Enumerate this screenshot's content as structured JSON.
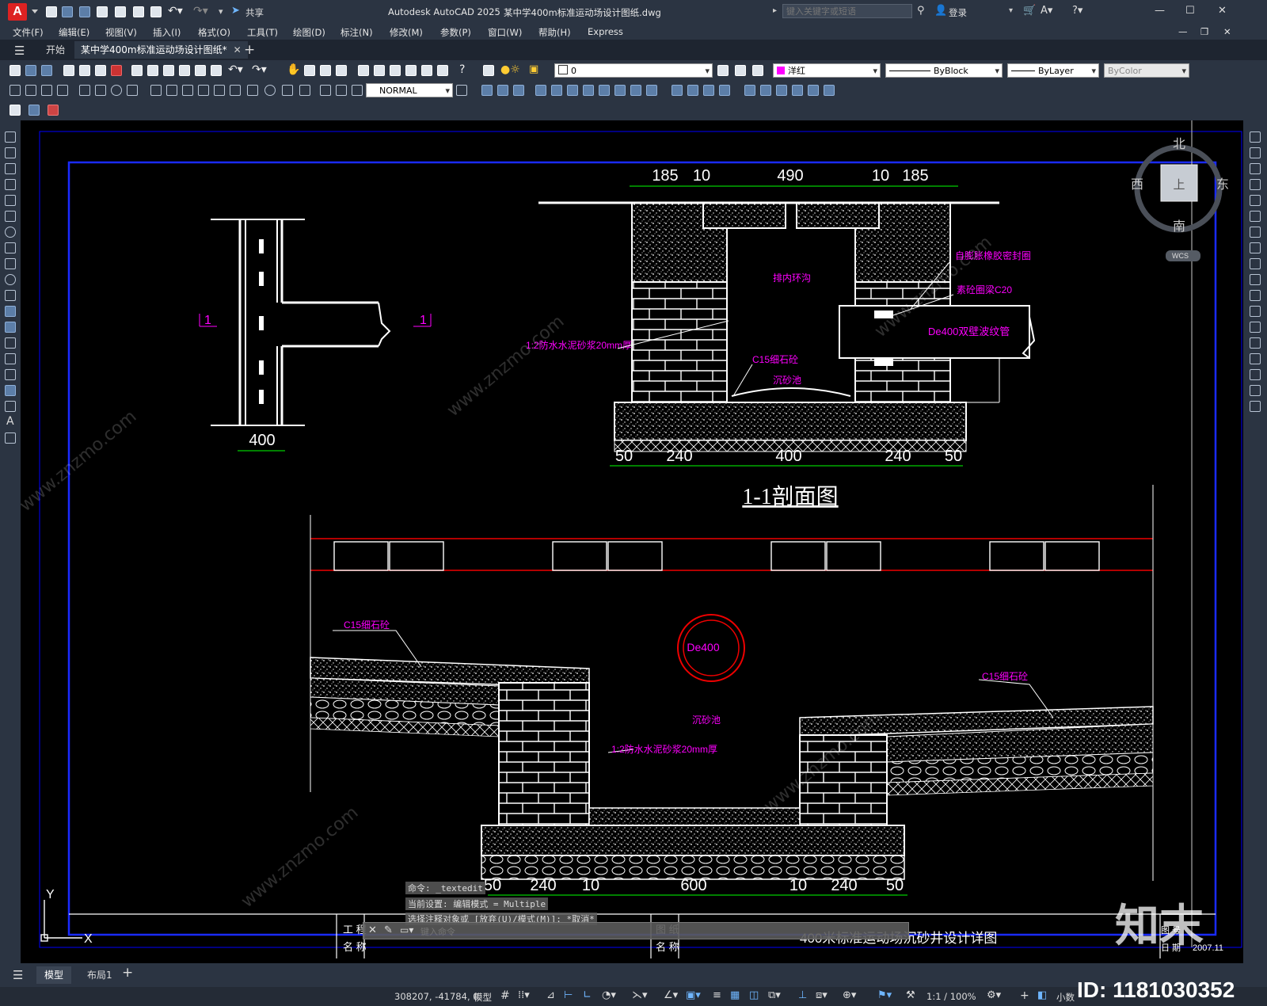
{
  "app": {
    "title": "Autodesk AutoCAD 2025",
    "filename": "某中学400m标准运动场设计图纸.dwg",
    "share": "共享",
    "search_placeholder": "键入关键字或短语",
    "login": "登录"
  },
  "menu": [
    "文件(F)",
    "编辑(E)",
    "视图(V)",
    "插入(I)",
    "格式(O)",
    "工具(T)",
    "绘图(D)",
    "标注(N)",
    "修改(M)",
    "参数(P)",
    "窗口(W)",
    "帮助(H)",
    "Express"
  ],
  "tabs": {
    "start": "开始",
    "doc": "某中学400m标准运动场设计图纸*"
  },
  "toolbar": {
    "layer": "0",
    "color": "洋红",
    "linetype": "ByBlock",
    "lineweight": "ByLayer",
    "plotstyle": "ByColor",
    "dimstyle": "NORMAL"
  },
  "viewcube": {
    "north": "北",
    "south": "南",
    "east": "东",
    "west": "西",
    "top": "上",
    "wcs": "WCS"
  },
  "drawing": {
    "dims_top": [
      "185",
      "10",
      "490",
      "10",
      "185"
    ],
    "dims_left": [
      "400"
    ],
    "dims_section_bottom": [
      "50",
      "240",
      "400",
      "240",
      "50"
    ],
    "section_title": "1-1剖面图",
    "section_marks": [
      "1",
      "1"
    ],
    "labels_section": {
      "inner_channel": "排内环沟",
      "seal": "自膨胀橡胶密封圈",
      "concrete_c20": "素砼圈梁C20",
      "pipe": "De400双壁波纹管",
      "mortar": "1:2防水水泥砂浆20mm厚",
      "c15": "C15细石砼",
      "sand_pit": "沉砂池"
    },
    "labels_lower": {
      "c15_left": "C15细石砼",
      "de400": "De400",
      "sand_pit": "沉砂池",
      "mortar": "1:2防水水泥砂浆20mm厚",
      "c15_right": "C15细石砼"
    },
    "dims_lower_bottom": [
      "50",
      "240",
      "10",
      "600",
      "10",
      "240",
      "50"
    ],
    "titleblock": {
      "project_label_1": "工 程",
      "project_label_2": "名 称",
      "drawing_label_1": "图 纸",
      "drawing_label_2": "名 称",
      "drawing_name": "400米标准运动场沉砂井设计详图",
      "no_label": "图 号",
      "date_label": "日 期",
      "date": "2007.11"
    },
    "ucs": {
      "y": "Y",
      "x": "X"
    }
  },
  "command": {
    "line1": "命令: _textedit",
    "line2": "当前设置: 编辑模式 = Multiple",
    "line3": "选择注释对象或 [放弃(U)/模式(M)]: *取消*",
    "placeholder": "键入命令"
  },
  "layout_tabs": [
    "模型",
    "布局1"
  ],
  "status": {
    "coords": "308207, -41784, 0",
    "model": "模型",
    "scale": "1:1 / 100%",
    "units": "小数"
  },
  "watermark": {
    "brand": "知末",
    "id": "ID: 1181030352",
    "site": "www.znzmo.com"
  }
}
